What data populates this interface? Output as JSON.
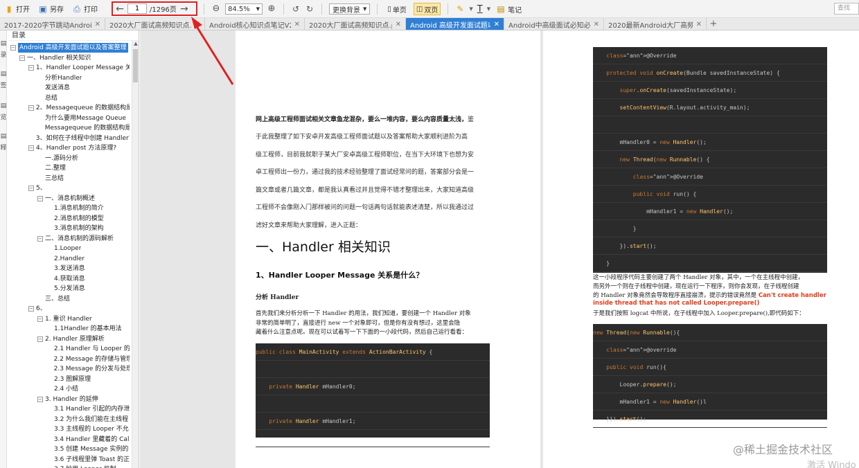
{
  "toolbar": {
    "open_label": "打开",
    "saveas_label": "另存",
    "print_label": "打印",
    "page_current": "1",
    "page_total": "/1296页",
    "zoom_value": "84.5%",
    "background_select": "更换背景",
    "single_page_label": "单页",
    "double_page_label": "双页",
    "text_tool_label": "T",
    "notes_label": "笔记",
    "search_placeholder": "查找"
  },
  "tabs": [
    {
      "label": "2017-2020字节跳动Android面试"
    },
    {
      "label": "2020大厂面试高频知识点.pdf"
    },
    {
      "label": "Android核心知识点笔记V2020"
    },
    {
      "label": "2020大厂面试高频知识点.pdf"
    },
    {
      "label": "Android 高级开发面试题以及答"
    },
    {
      "label": "Android中高级面试必知必会.p"
    },
    {
      "label": "2020最新Android大厂高频面试"
    }
  ],
  "rail": [
    "录",
    "签",
    "览",
    "释"
  ],
  "outline": {
    "title": "目录",
    "items": [
      {
        "label": "Android 高级开发面试题以及答案整理",
        "selected": true
      },
      {
        "label": "一、Handler 相关知识"
      },
      {
        "label": "1、Handler Looper Message 关"
      },
      {
        "label": "分析Handler"
      },
      {
        "label": "发送消息"
      },
      {
        "label": "总结"
      },
      {
        "label": "2、Messagequeue 的数据结构是"
      },
      {
        "label": "为什么要用Message Queue"
      },
      {
        "label": "Messagequeue 的数据结构是"
      },
      {
        "label": "3、如何在子线程中创建 Handler?"
      },
      {
        "label": "4、Handler post 方法原理?"
      },
      {
        "label": "一.源码分析"
      },
      {
        "label": "二.整理"
      },
      {
        "label": "三总结"
      },
      {
        "label": "5、"
      },
      {
        "label": "一、消息机制概述"
      },
      {
        "label": "1.消息机制的简介"
      },
      {
        "label": "2.消息机制的模型"
      },
      {
        "label": "3.消息机制的架构"
      },
      {
        "label": "二、消息机制的源码解析"
      },
      {
        "label": "1.Looper"
      },
      {
        "label": "2.Handler"
      },
      {
        "label": "3.发送消息"
      },
      {
        "label": "4.获取消息"
      },
      {
        "label": "5.分发消息"
      },
      {
        "label": "三、总结"
      },
      {
        "label": "6、"
      },
      {
        "label": "1. 重识 Handler"
      },
      {
        "label": "1.1Handler 的基本用法"
      },
      {
        "label": "2. Handler 原理解析"
      },
      {
        "label": "2.1 Handler 与 Looper 的"
      },
      {
        "label": "2.2 Message 的存储与管理"
      },
      {
        "label": "2.3 Message 的分发与处理"
      },
      {
        "label": "2.3 图解原理"
      },
      {
        "label": "2.4 小结"
      },
      {
        "label": "3. Handler 的延伸"
      },
      {
        "label": "3.1 Handler 引起的内存泄"
      },
      {
        "label": "3.2 为什么我们能在主线程"
      },
      {
        "label": "3.3 主线程的 Looper 不允"
      },
      {
        "label": "3.4 Handler 里藏着的 Call"
      },
      {
        "label": "3.5 创建 Message 实例的"
      },
      {
        "label": "3.6 子线程里弹 Toast 的正"
      },
      {
        "label": "3.7 妙用 Looper 机制"
      }
    ]
  },
  "left_page": {
    "intro_bold": "网上高级工程师面试相关文章鱼龙混杂，要么一堆内容，要么内容质量太浅，",
    "intro_tail": "鉴",
    "intro_lines": [
      "于此我整理了如下安卓开发高级工程师面试题以及答案帮助大家顺利进阶为高",
      "级工程师，目前我就职于某大厂安卓高级工程师职位，在当下大环境下也想为安",
      "卓工程师出一份力，通过我的技术经验整理了面试经常问的题，答案部分会是一",
      "篇文章或者几篇文章，都是我认真看过并且觉得不错才整理出来，大家知道高级",
      "工程师不会像刚入门那样被问的问题一句话两句话就能表述清楚，所以我通过过",
      "滤好文章来帮助大家理解，进入正题："
    ],
    "h1": "一、Handler  相关知识",
    "h2": "1、Handler Looper Message  关系是什么？",
    "h3": "分析 Handler",
    "body_lines": [
      "首先我们来分析分析一下 Handler 的用法，我们知道，要创建一个 Handler 对象",
      "非常的简单明了，直接进行 new 一个对象即可，但是你有没有想过，这里会隐",
      "藏着什么注意点呢。现在可以试着写一下下面的一小段代码，然后自己运行看看："
    ],
    "code": [
      "public class MainActivity extends ActionBarActivity {",
      "",
      "    private Handler mHandler0;",
      "",
      "    private Handler mHandler1;",
      ""
    ]
  },
  "right_page": {
    "code_top": [
      "    @Override",
      "    protected void onCreate(Bundle savedInstanceState) {",
      "        super.onCreate(savedInstanceState);",
      "        setContentView(R.layout.activity_main);",
      "",
      "        mHandler0 = new Handler();",
      "        new Thread(new Runnable() {",
      "            @Override",
      "            public void run() {",
      "                mHandler1 = new Handler();",
      "            }",
      "        }).start();",
      "    }"
    ],
    "text_lines": [
      "这一小段程序代码主要创建了两个 Handler 对象，其中，一个在主线程中创建，",
      "而另外一个则在子线程中创建，现在运行一下程序，则你会发现，在子线程创建",
      "的 Handler 对象竟然会导致程序直接崩溃，提示的错误竟然是"
    ],
    "error_part1": "Can't create handler",
    "error_part2": "inside thread that has not called Looper.prepare()",
    "after_line": "于是我们按照 logcat 中所说，在子线程中加入 Looper.prepare(),即代码如下：",
    "code_bottom": [
      "new Thread(new Runnable(){",
      "    @override",
      "    public void run(){",
      "        Looper.prepare();",
      "        mHandler1 = new Handler()l",
      "    }}).start();"
    ]
  },
  "watermark": "@稀土掘金技术社区",
  "activate_text": "激活 Windo"
}
